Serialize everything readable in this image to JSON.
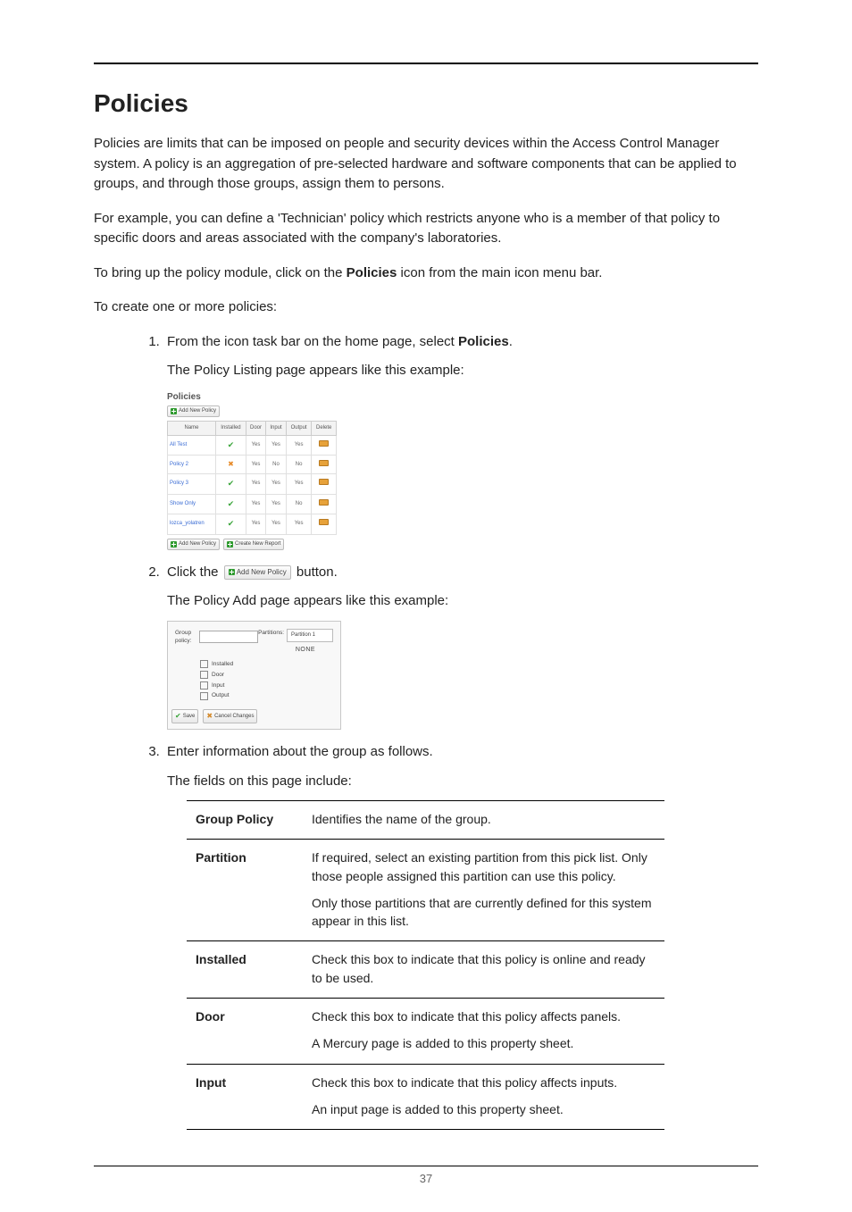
{
  "title": "Policies",
  "intro": [
    "Policies are limits that can be imposed on people and security devices within the Access Control Manager system. A policy is an aggregation of pre-selected hardware and software components that can be applied to groups, and through those groups, assign them to persons.",
    "For example, you can define a 'Technician' policy which restricts anyone who is a member of that policy to specific doors and areas associated with the company's laboratories."
  ],
  "bring_up": {
    "pre": "To bring up the policy module, click on the ",
    "bold": "Policies",
    "post": " icon from the main icon menu bar."
  },
  "to_create": "To create one or more policies:",
  "step1": {
    "text_pre": "From the icon task bar on the home page, select ",
    "text_bold": "Policies",
    "text_post": ".",
    "caption": "The Policy Listing page appears like this example:"
  },
  "step2": {
    "pre": "Click the  ",
    "post": "  button.",
    "caption": "The Policy Add page appears like this example:"
  },
  "step3": {
    "text": "Enter information about the group as follows.",
    "caption": "The fields on this page include:"
  },
  "listing": {
    "title": "Policies",
    "add_btn": "Add New Policy",
    "headers": [
      "Name",
      "Installed",
      "Door",
      "Input",
      "Output",
      "Delete"
    ],
    "rows": [
      {
        "name": "All Test",
        "installed": "check",
        "door": "Yes",
        "input": "Yes",
        "output": "Yes"
      },
      {
        "name": "Policy 2",
        "installed": "x",
        "door": "Yes",
        "input": "No",
        "output": "No"
      },
      {
        "name": "Policy 3",
        "installed": "check",
        "door": "Yes",
        "input": "Yes",
        "output": "Yes"
      },
      {
        "name": "Show Only",
        "installed": "check",
        "door": "Yes",
        "input": "Yes",
        "output": "No"
      },
      {
        "name": "lozca_yolatren",
        "installed": "check",
        "door": "Yes",
        "input": "Yes",
        "output": "Yes"
      }
    ],
    "footer_add": "Add New Policy",
    "footer_report": "Create New Report"
  },
  "inline_add_btn": "Add New Policy",
  "add_form": {
    "group_label": "Group policy:",
    "partitions_label": "Partitions:",
    "partition_option": "Partition 1",
    "none": "NONE",
    "checkboxes": [
      "Installed",
      "Door",
      "Input",
      "Output"
    ],
    "save": "Save",
    "cancel": "Cancel Changes"
  },
  "fields": [
    {
      "name": "Group Policy",
      "desc": [
        "Identifies the name of the group."
      ]
    },
    {
      "name": "Partition",
      "desc": [
        "If required, select an existing partition from this pick list. Only those people assigned this partition can use this policy.",
        "Only those partitions that are currently defined for this system appear in this list."
      ]
    },
    {
      "name": "Installed",
      "desc": [
        "Check this box to indicate that this policy is online and ready to be used."
      ]
    },
    {
      "name": "Door",
      "desc": [
        "Check this box to indicate that this policy affects panels.",
        "A Mercury page is added to this property sheet."
      ]
    },
    {
      "name": "Input",
      "desc": [
        "Check this box to indicate that this policy affects inputs.",
        "An input page is added to this property sheet."
      ]
    }
  ],
  "page_number": "37"
}
